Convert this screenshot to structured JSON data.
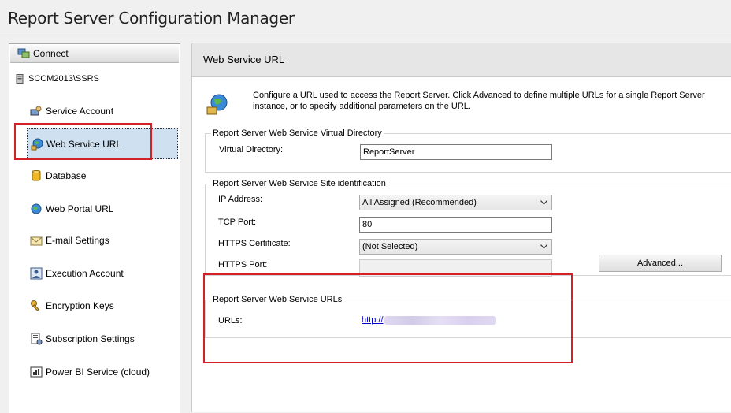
{
  "window": {
    "title": "Report Server Configuration Manager"
  },
  "sidebar": {
    "connect_label": "Connect",
    "server_name": "SCCM2013\\SSRS",
    "items": [
      {
        "label": "Service Account",
        "icon": "service-account-icon"
      },
      {
        "label": "Web Service URL",
        "icon": "web-service-url-icon",
        "selected": true
      },
      {
        "label": "Database",
        "icon": "database-icon"
      },
      {
        "label": "Web Portal URL",
        "icon": "globe-icon"
      },
      {
        "label": "E-mail Settings",
        "icon": "email-icon"
      },
      {
        "label": "Execution Account",
        "icon": "execution-account-icon"
      },
      {
        "label": "Encryption Keys",
        "icon": "key-icon"
      },
      {
        "label": "Subscription Settings",
        "icon": "subscription-icon"
      },
      {
        "label": "Power BI Service (cloud)",
        "icon": "power-bi-icon"
      }
    ]
  },
  "main": {
    "header": "Web Service URL",
    "description": "Configure a URL used to access the Report Server.  Click Advanced to define multiple URLs for a single Report Server instance, or to specify additional parameters on the URL.",
    "virtual_directory_group": {
      "legend": "Report Server Web Service Virtual Directory",
      "label": "Virtual Directory:",
      "value": "ReportServer"
    },
    "site_identification_group": {
      "legend": "Report Server Web Service Site identification",
      "ip_label": "IP Address:",
      "ip_value": "All Assigned (Recommended)",
      "tcp_label": "TCP Port:",
      "tcp_value": "80",
      "https_cert_label": "HTTPS Certificate:",
      "https_cert_value": "(Not Selected)",
      "https_port_label": "HTTPS Port:",
      "https_port_value": "",
      "advanced_label": "Advanced..."
    },
    "urls_group": {
      "legend": "Report Server Web Service URLs",
      "label": "URLs:",
      "url": "http://"
    }
  },
  "colors": {
    "highlight": "#d42027",
    "selected_bg": "#cfe0f0",
    "link": "#0000cc"
  }
}
